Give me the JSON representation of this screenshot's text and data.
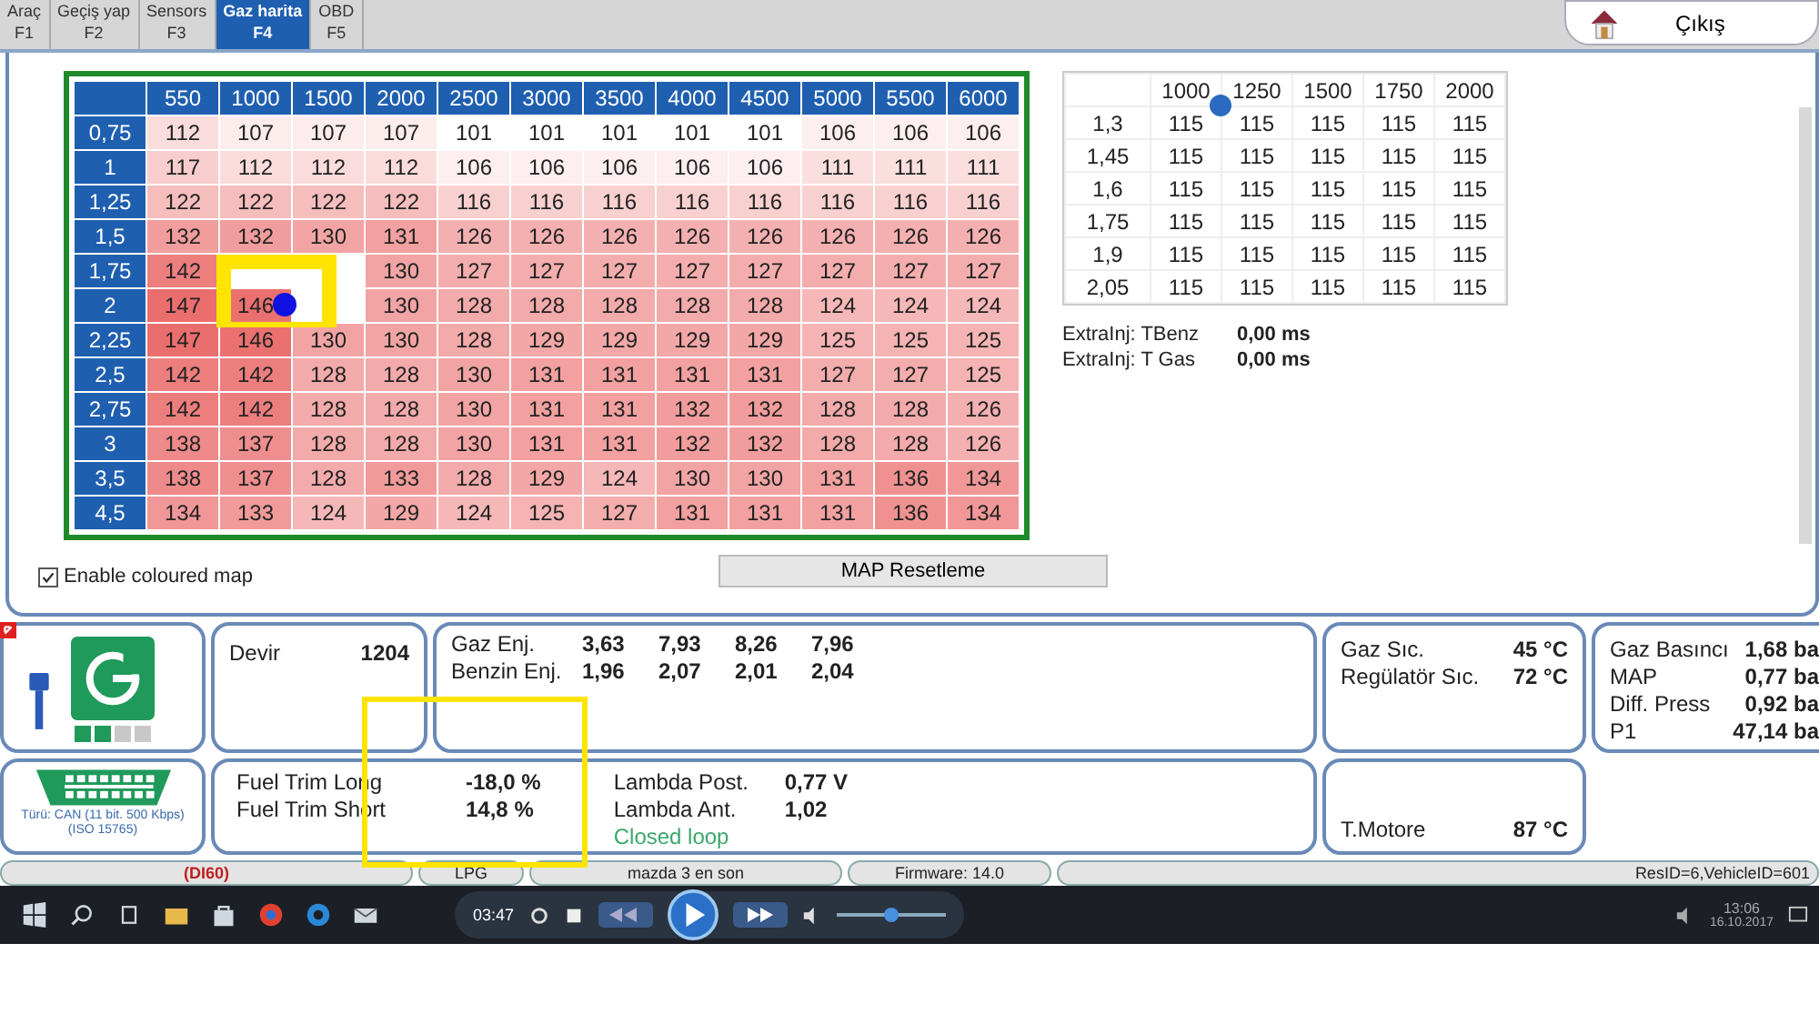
{
  "tabs": [
    {
      "label": "Araç",
      "key": "F1",
      "selected": false
    },
    {
      "label": "Geçiş yap",
      "key": "F2",
      "selected": false
    },
    {
      "label": "Sensors",
      "key": "F3",
      "selected": false
    },
    {
      "label": "Gaz harita",
      "key": "F4",
      "selected": true
    },
    {
      "label": "OBD",
      "key": "F5",
      "selected": false
    }
  ],
  "exit_button": {
    "label": "Çıkış"
  },
  "gas_map": {
    "columns": [
      "550",
      "1000",
      "1500",
      "2000",
      "2500",
      "3000",
      "3500",
      "4000",
      "4500",
      "5000",
      "5500",
      "6000"
    ],
    "rows": [
      {
        "label": "0,75",
        "cells": [
          "112",
          "107",
          "107",
          "107",
          "101",
          "101",
          "101",
          "101",
          "101",
          "106",
          "106",
          "106"
        ]
      },
      {
        "label": "1",
        "cells": [
          "117",
          "112",
          "112",
          "112",
          "106",
          "106",
          "106",
          "106",
          "106",
          "111",
          "111",
          "111"
        ]
      },
      {
        "label": "1,25",
        "cells": [
          "122",
          "122",
          "122",
          "122",
          "116",
          "116",
          "116",
          "116",
          "116",
          "116",
          "116",
          "116"
        ]
      },
      {
        "label": "1,5",
        "cells": [
          "132",
          "132",
          "130",
          "131",
          "126",
          "126",
          "126",
          "126",
          "126",
          "126",
          "126",
          "126"
        ]
      },
      {
        "label": "1,75",
        "cells": [
          "142",
          null,
          null,
          "130",
          "127",
          "127",
          "127",
          "127",
          "127",
          "127",
          "127",
          "127"
        ]
      },
      {
        "label": "2",
        "cells": [
          "147",
          "146",
          null,
          "130",
          "128",
          "128",
          "128",
          "128",
          "128",
          "124",
          "124",
          "124"
        ]
      },
      {
        "label": "2,25",
        "cells": [
          "147",
          "146",
          "130",
          "130",
          "128",
          "129",
          "129",
          "129",
          "129",
          "125",
          "125",
          "125"
        ]
      },
      {
        "label": "2,5",
        "cells": [
          "142",
          "142",
          "128",
          "128",
          "130",
          "131",
          "131",
          "131",
          "131",
          "127",
          "127",
          "125"
        ]
      },
      {
        "label": "2,75",
        "cells": [
          "142",
          "142",
          "128",
          "128",
          "130",
          "131",
          "131",
          "132",
          "132",
          "128",
          "128",
          "126"
        ]
      },
      {
        "label": "3",
        "cells": [
          "138",
          "137",
          "128",
          "128",
          "130",
          "131",
          "131",
          "132",
          "132",
          "128",
          "128",
          "126"
        ]
      },
      {
        "label": "3,5",
        "cells": [
          "138",
          "137",
          "128",
          "133",
          "128",
          "129",
          "124",
          "130",
          "130",
          "131",
          "136",
          "134"
        ]
      },
      {
        "label": "4,5",
        "cells": [
          "134",
          "133",
          "124",
          "129",
          "124",
          "125",
          "127",
          "131",
          "131",
          "131",
          "136",
          "134"
        ]
      }
    ]
  },
  "small_map": {
    "columns": [
      "1000",
      "1250",
      "1500",
      "1750",
      "2000"
    ],
    "rows": [
      {
        "label": "1,3",
        "cells": [
          "115",
          "115",
          "115",
          "115",
          "115"
        ]
      },
      {
        "label": "1,45",
        "cells": [
          "115",
          "115",
          "115",
          "115",
          "115"
        ]
      },
      {
        "label": "1,6",
        "cells": [
          "115",
          "115",
          "115",
          "115",
          "115"
        ]
      },
      {
        "label": "1,75",
        "cells": [
          "115",
          "115",
          "115",
          "115",
          "115"
        ]
      },
      {
        "label": "1,9",
        "cells": [
          "115",
          "115",
          "115",
          "115",
          "115"
        ]
      },
      {
        "label": "2,05",
        "cells": [
          "115",
          "115",
          "115",
          "115",
          "115"
        ]
      }
    ]
  },
  "extra_injection": [
    {
      "label": "ExtraInj: TBenz",
      "value": "0,00 ms"
    },
    {
      "label": "ExtraInj: T Gas",
      "value": "0,00 ms"
    }
  ],
  "coloured_map": {
    "label": "Enable coloured map",
    "checked": true
  },
  "reset_button": {
    "label": "MAP Resetleme"
  },
  "status": {
    "level": 0.5
  },
  "rpm": {
    "label": "Devir",
    "value": "1204"
  },
  "injection": [
    {
      "label": "Gaz Enj.",
      "values": [
        "3,63",
        "7,93",
        "8,26",
        "7,96"
      ]
    },
    {
      "label": "Benzin Enj.",
      "values": [
        "1,96",
        "2,07",
        "2,01",
        "2,04"
      ]
    }
  ],
  "temperatures": [
    {
      "label": "Gaz Sıc.",
      "value": "45 °C"
    },
    {
      "label": "Regülatör Sıc.",
      "value": "72 °C"
    }
  ],
  "pressures": [
    {
      "label": "Gaz Basıncı",
      "value": "1,68 ba"
    },
    {
      "label": "MAP",
      "value": "0,77 ba"
    },
    {
      "label": "Diff. Press",
      "value": "0,92 ba"
    },
    {
      "label": "P1",
      "value": "47,14 ba"
    }
  ],
  "obd": {
    "protocol": "Türü: CAN (11 bit. 500 Kbps) (ISO 15765)"
  },
  "fuel_trim": [
    {
      "label": "Fuel Trim Long",
      "value": "-18,0 %"
    },
    {
      "label": "Fuel Trim Short",
      "value": "14,8 %"
    }
  ],
  "lambda": [
    {
      "label": "Lambda Post.",
      "value": "0,77 V"
    },
    {
      "label": "Lambda Ant.",
      "value": "1,02"
    }
  ],
  "loop_status": "Closed loop",
  "engine_temp": {
    "label": "T.Motore",
    "value": "87 °C"
  },
  "status_bar": [
    "(DI60)",
    "LPG",
    "mazda 3 en son",
    "Firmware: 14.0",
    "ResID=6,VehicleID=601"
  ],
  "video": {
    "time": "03:47",
    "level": 0.5
  },
  "taskbar": {
    "time": "13:06",
    "date": "16.10.2017"
  }
}
